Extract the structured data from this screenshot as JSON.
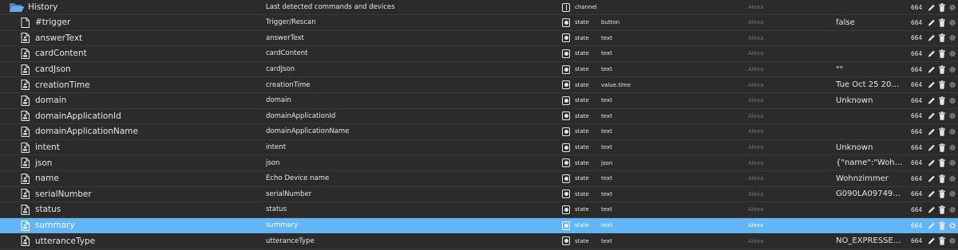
{
  "rows": [
    {
      "id": "History",
      "name": "Last detected commands and devices",
      "type": "channel",
      "role": "",
      "room": "Alexa",
      "value": "",
      "acl": "664",
      "kind": "folder"
    },
    {
      "id": "#trigger",
      "name": "Trigger/Rescan",
      "type": "state",
      "role": "button",
      "room": "Alexa",
      "value": "false",
      "acl": "664",
      "kind": "file"
    },
    {
      "id": "answerText",
      "name": "answerText",
      "type": "state",
      "role": "text",
      "room": "Alexa",
      "value": "",
      "acl": "664",
      "kind": "file-data"
    },
    {
      "id": "cardContent",
      "name": "cardContent",
      "type": "state",
      "role": "text",
      "room": "Alexa",
      "value": "",
      "acl": "664",
      "kind": "file-data"
    },
    {
      "id": "cardJson",
      "name": "cardJson",
      "type": "state",
      "role": "text",
      "room": "Alexa",
      "value": "\"\"",
      "acl": "664",
      "kind": "file-data"
    },
    {
      "id": "creationTime",
      "name": "creationTime",
      "type": "state",
      "role": "value.time",
      "room": "Alexa",
      "value": "Tue Oct 25 2022 ...",
      "acl": "664",
      "kind": "file-data"
    },
    {
      "id": "domain",
      "name": "domain",
      "type": "state",
      "role": "text",
      "room": "Alexa",
      "value": "Unknown",
      "acl": "664",
      "kind": "file-data"
    },
    {
      "id": "domainApplicationId",
      "name": "domainApplicationId",
      "type": "state",
      "role": "text",
      "room": "Alexa",
      "value": "",
      "acl": "664",
      "kind": "file-data"
    },
    {
      "id": "domainApplicationName",
      "name": "domainApplicationName",
      "type": "state",
      "role": "text",
      "room": "Alexa",
      "value": "",
      "acl": "664",
      "kind": "file-data"
    },
    {
      "id": "intent",
      "name": "intent",
      "type": "state",
      "role": "text",
      "room": "Alexa",
      "value": "Unknown",
      "acl": "664",
      "kind": "file-data"
    },
    {
      "id": "json",
      "name": "json",
      "type": "state",
      "role": "json",
      "room": "Alexa",
      "value": "{\"name\":\"Wohnzi...",
      "acl": "664",
      "kind": "file-data"
    },
    {
      "id": "name",
      "name": "Echo Device name",
      "type": "state",
      "role": "text",
      "room": "Alexa",
      "value": "Wohnzimmer",
      "acl": "664",
      "kind": "file-data"
    },
    {
      "id": "serialNumber",
      "name": "serialNumber",
      "type": "state",
      "role": "text",
      "room": "Alexa",
      "value": "G090LA09749400...",
      "acl": "664",
      "kind": "file-data"
    },
    {
      "id": "status",
      "name": "status",
      "type": "state",
      "role": "text",
      "room": "Alexa",
      "value": "",
      "acl": "664",
      "kind": "file-data"
    },
    {
      "id": "summary",
      "name": "summary",
      "type": "state",
      "role": "text",
      "room": "Alexa",
      "value": "",
      "acl": "664",
      "kind": "file-data",
      "selected": true
    },
    {
      "id": "utteranceType",
      "name": "utteranceType",
      "type": "state",
      "role": "text",
      "room": "Alexa",
      "value": "NO_EXPRESSED_I...",
      "acl": "664",
      "kind": "file-data"
    }
  ],
  "icons": {
    "folder": "folder-open-icon",
    "file": "file-icon",
    "file_data": "file-data-icon",
    "edit": "pencil-icon",
    "delete": "trash-icon",
    "settings": "gear-icon"
  },
  "colors": {
    "background": "#2b2b2b",
    "selected": "#64b5f6",
    "folder": "#5b9bd5",
    "text": "#e6e6e6",
    "room": "#777777"
  }
}
